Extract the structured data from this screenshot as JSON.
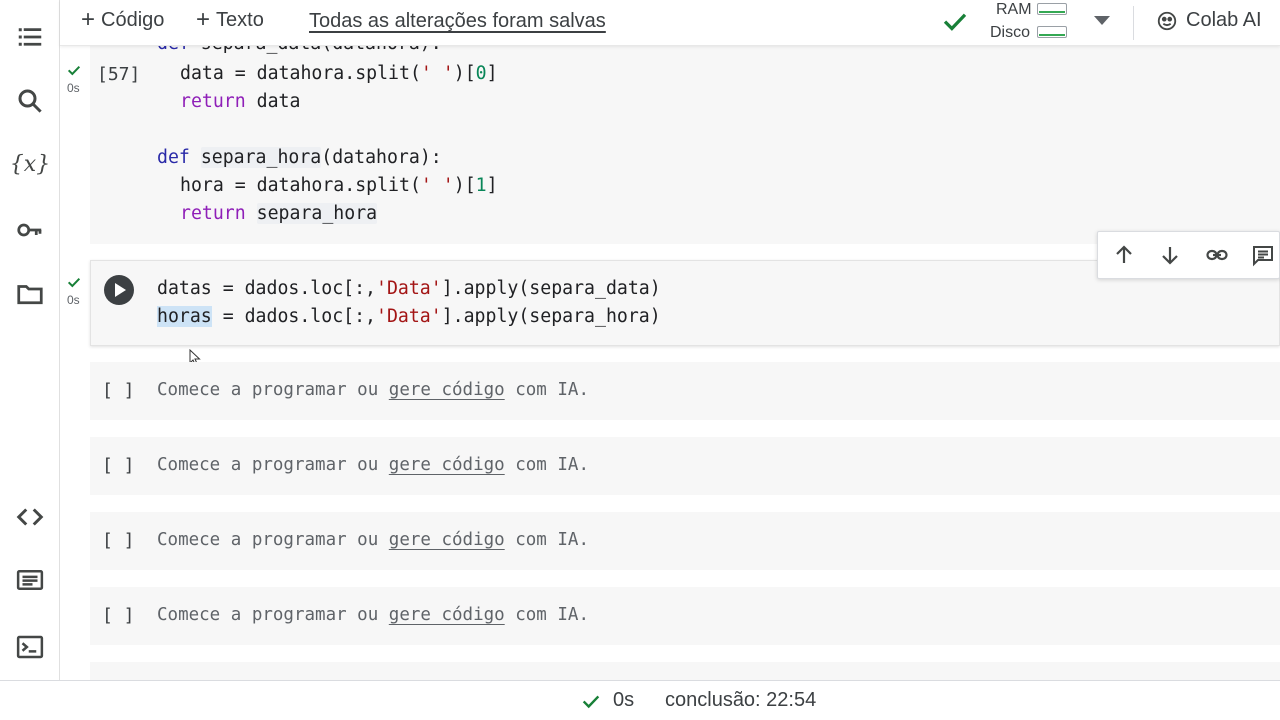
{
  "sidebar": {
    "icons": [
      "table-of-contents-icon",
      "search-icon",
      "variables-icon",
      "secrets-key-icon",
      "files-folder-icon",
      "code-snippets-icon",
      "command-palette-icon",
      "terminal-icon"
    ],
    "variables_glyph": "{x}"
  },
  "toolbar": {
    "add_code_label": "Código",
    "add_text_label": "Texto",
    "saved_status": "Todas as alterações foram salvas",
    "ram_label": "RAM",
    "disk_label": "Disco",
    "colab_ai_label": "Colab AI"
  },
  "cells": {
    "cell1": {
      "exec_count": "[57]",
      "status_time": "0s",
      "lines": {
        "l0_kw": "def",
        "l0_rest": " separa_data(datahora):",
        "l1_a": "data = datahora.split(",
        "l1_str": "' '",
        "l1_b": ")[",
        "l1_num": "0",
        "l1_c": "]",
        "l2_kw": "return",
        "l2_rest": " data",
        "l4_kw": "def",
        "l4_sp": " ",
        "l4_name": "separa_hora",
        "l4_rest": "(datahora):",
        "l5_a": "hora = datahora.split(",
        "l5_str": "' '",
        "l5_b": ")[",
        "l5_num": "1",
        "l5_c": "]",
        "l6_kw": "return",
        "l6_sp": " ",
        "l6_name": "separa_hora"
      }
    },
    "cell2": {
      "status_time": "0s",
      "lines": {
        "l0_a": "datas = dados.loc[:,",
        "l0_str": "'Data'",
        "l0_b": "].apply(separa_data)",
        "l1_sel": "horas",
        "l1_a": " = dados.loc[:,",
        "l1_str": "'Data'",
        "l1_b": "].apply(separa_hora)"
      }
    },
    "empty": {
      "bracket": "[ ]",
      "text_a": "Comece a programar ou ",
      "text_link": "gere código",
      "text_b": " com IA."
    }
  },
  "cell_toolbar": {
    "icons": [
      "move-up-icon",
      "move-down-icon",
      "link-icon",
      "comment-icon"
    ]
  },
  "statusbar": {
    "time": "0s",
    "completion": "conclusão: 22:54"
  },
  "colors": {
    "accent_green": "#188038",
    "keyword": "#8f1fb8",
    "string": "#a31515",
    "number": "#098658",
    "cell_background": "#f7f7f7"
  }
}
